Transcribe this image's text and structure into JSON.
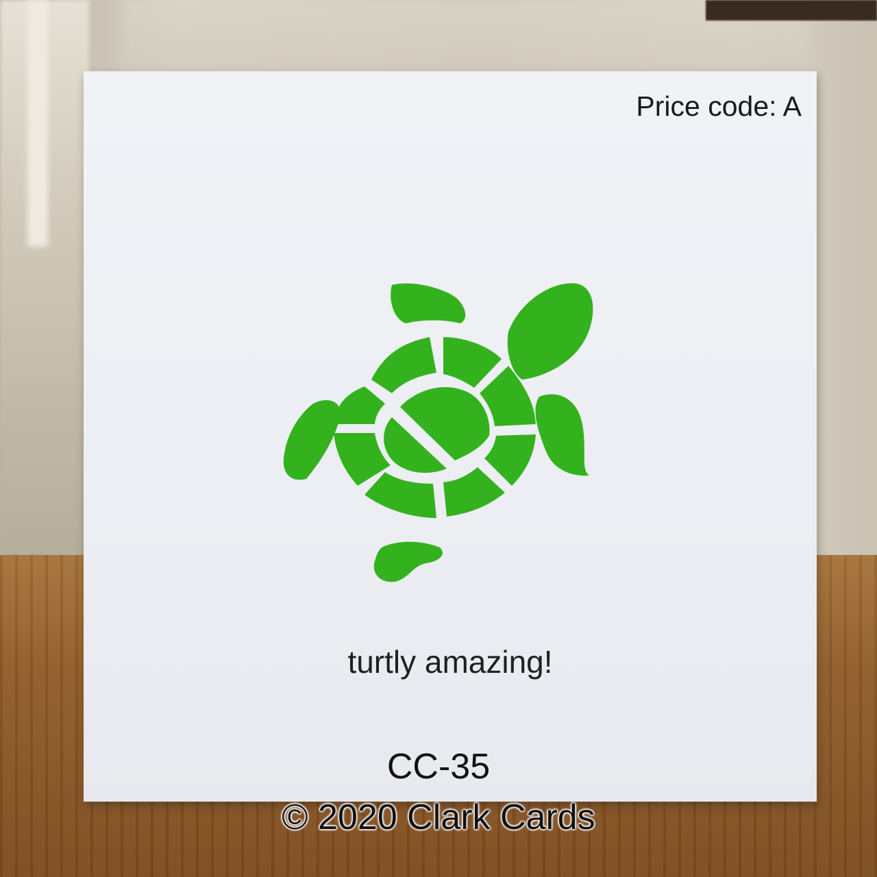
{
  "card": {
    "price_code": "Price code: A",
    "message": "turtly amazing!",
    "product_code": "CC-35"
  },
  "watermark": {
    "text": "© 2020 Clark Cards"
  },
  "colors": {
    "card": "#eceef3",
    "turtle_green": "#33b21e",
    "text": "#1a1a1a",
    "table_wood": "#8e5b29"
  },
  "icons": {
    "turtle": "sea-turtle-icon"
  }
}
